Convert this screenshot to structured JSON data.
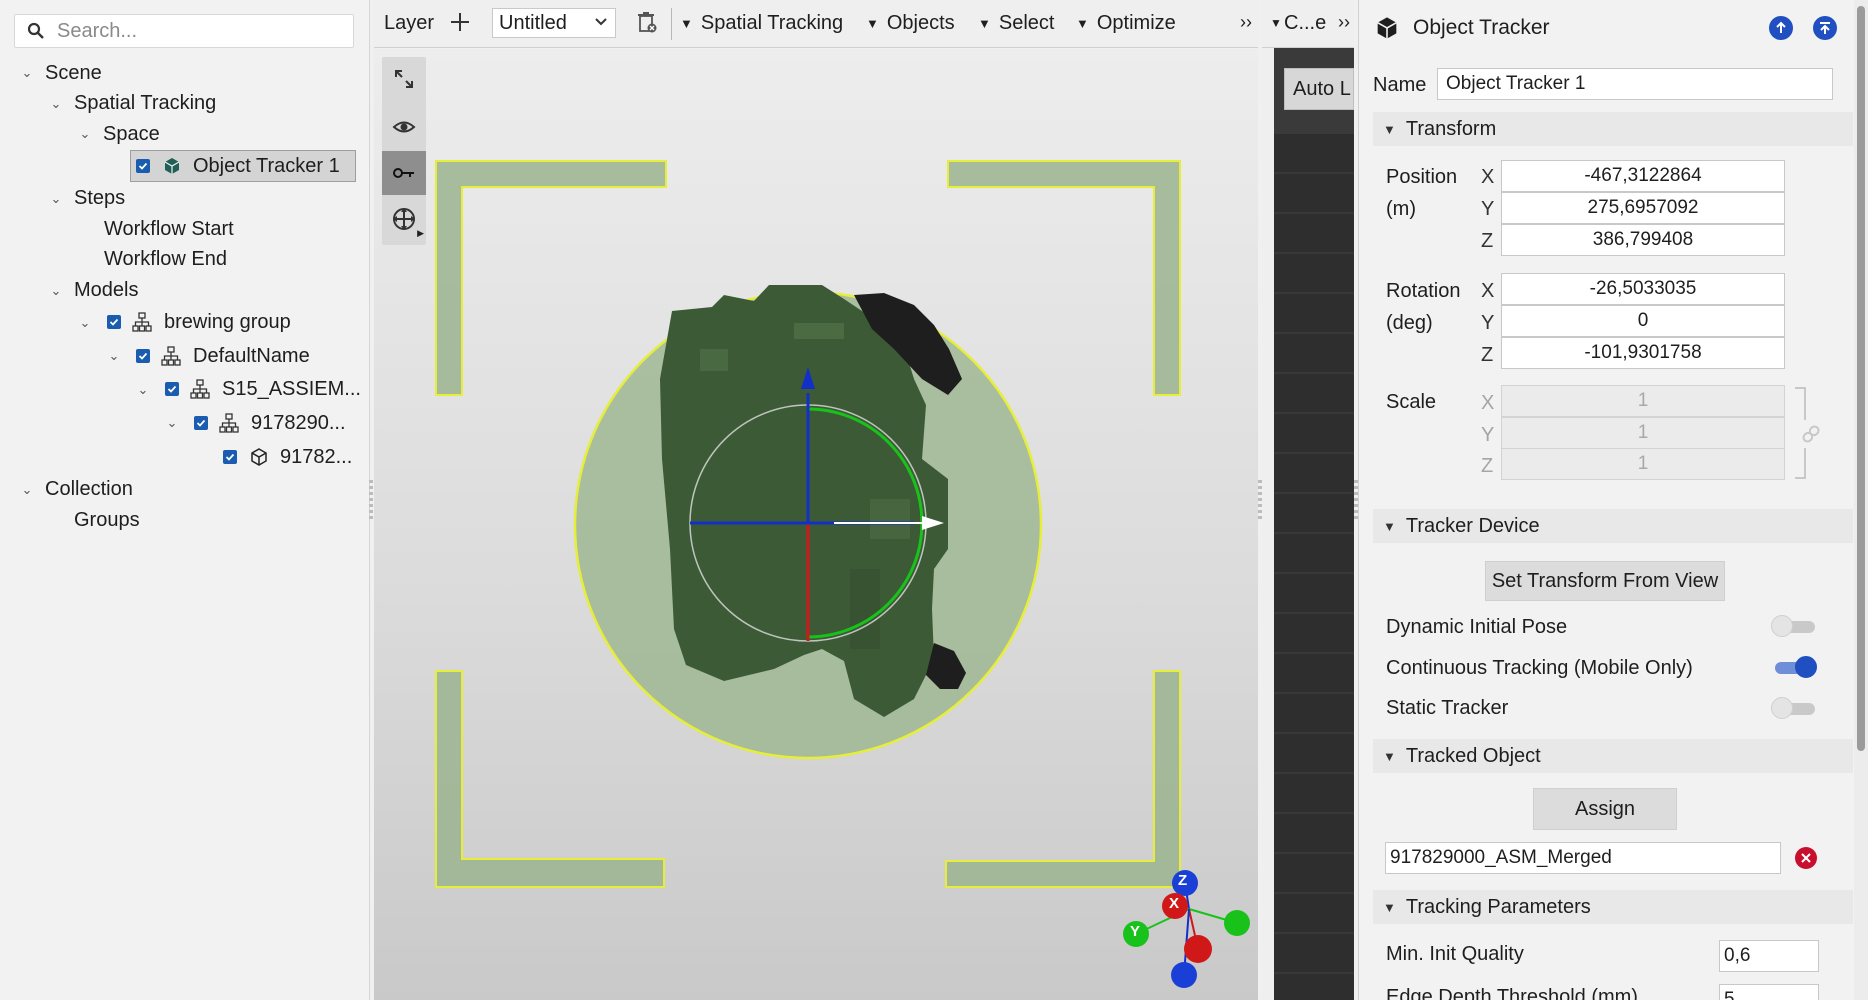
{
  "search": {
    "placeholder": "Search..."
  },
  "tree": {
    "scene": "Scene",
    "spatial_tracking": "Spatial Tracking",
    "space": "Space",
    "object_tracker": "Object Tracker 1",
    "steps": "Steps",
    "workflow_start": "Workflow Start",
    "workflow_end": "Workflow End",
    "models": "Models",
    "brewing_group": "brewing group",
    "default_name": "DefaultName",
    "s15": "S15_ASSIEM...",
    "n9178290": "9178290...",
    "n91782": "91782...",
    "collection": "Collection",
    "groups": "Groups"
  },
  "toolbar": {
    "layer": "Layer",
    "layer_value": "Untitled",
    "spatial_tracking": "Spatial Tracking",
    "objects": "Objects",
    "select": "Select",
    "optimize": "Optimize",
    "overflow": "››"
  },
  "mid": {
    "title": "C...e",
    "overflow": "››",
    "auto_btn": "Auto L"
  },
  "inspector": {
    "title": "Object Tracker",
    "name_label": "Name",
    "name_value": "Object Tracker 1",
    "transform": "Transform",
    "position_label": "Position",
    "position_unit": "(m)",
    "pos_x": "-467,3122864",
    "pos_y": "275,6957092",
    "pos_z": "386,799408",
    "rotation_label": "Rotation",
    "rotation_unit": "(deg)",
    "rot_x": "-26,5033035",
    "rot_y": "0",
    "rot_z": "-101,9301758",
    "scale_label": "Scale",
    "scale_x": "1",
    "scale_y": "1",
    "scale_z": "1",
    "axis_x": "X",
    "axis_y": "Y",
    "axis_z": "Z",
    "tracker_device": "Tracker Device",
    "set_transform": "Set Transform From View",
    "dynamic_initial_pose": "Dynamic Initial Pose",
    "continuous_tracking": "Continuous Tracking (Mobile Only)",
    "static_tracker": "Static Tracker",
    "tracked_object": "Tracked Object",
    "assign": "Assign",
    "tracked_value": "917829000_ASM_Merged",
    "tracking_parameters": "Tracking Parameters",
    "min_init_quality": "Min. Init Quality",
    "min_init_value": "0,6",
    "edge_depth": "Edge Depth Threshold (mm)",
    "edge_depth_value": "5"
  },
  "gizmo": {
    "z": "Z",
    "x": "X",
    "y": "Y"
  },
  "colors": {
    "accent": "#1f4fc0",
    "highlight": "#e6ee3a",
    "model": "#3c5a36"
  }
}
